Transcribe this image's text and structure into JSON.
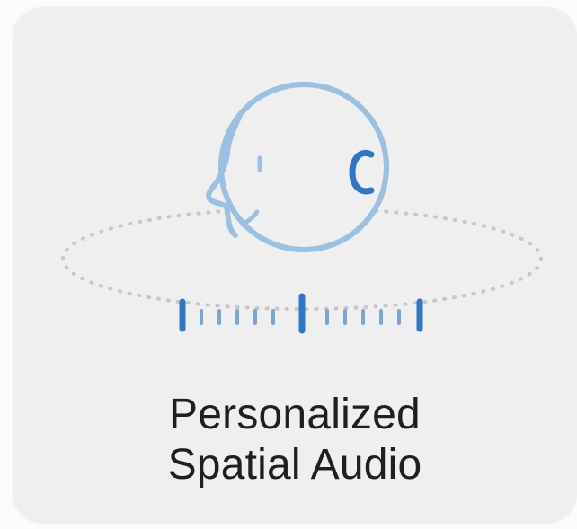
{
  "tile": {
    "title_line1": "Personalized",
    "title_line2": "Spatial Audio"
  },
  "icon": {
    "name": "personalized-spatial-audio-icon",
    "face_color": "#9cc0e2",
    "accent_color": "#2f76c9",
    "tick_color": "#7aa6d6",
    "orbit_color": "#c7c7c7"
  }
}
